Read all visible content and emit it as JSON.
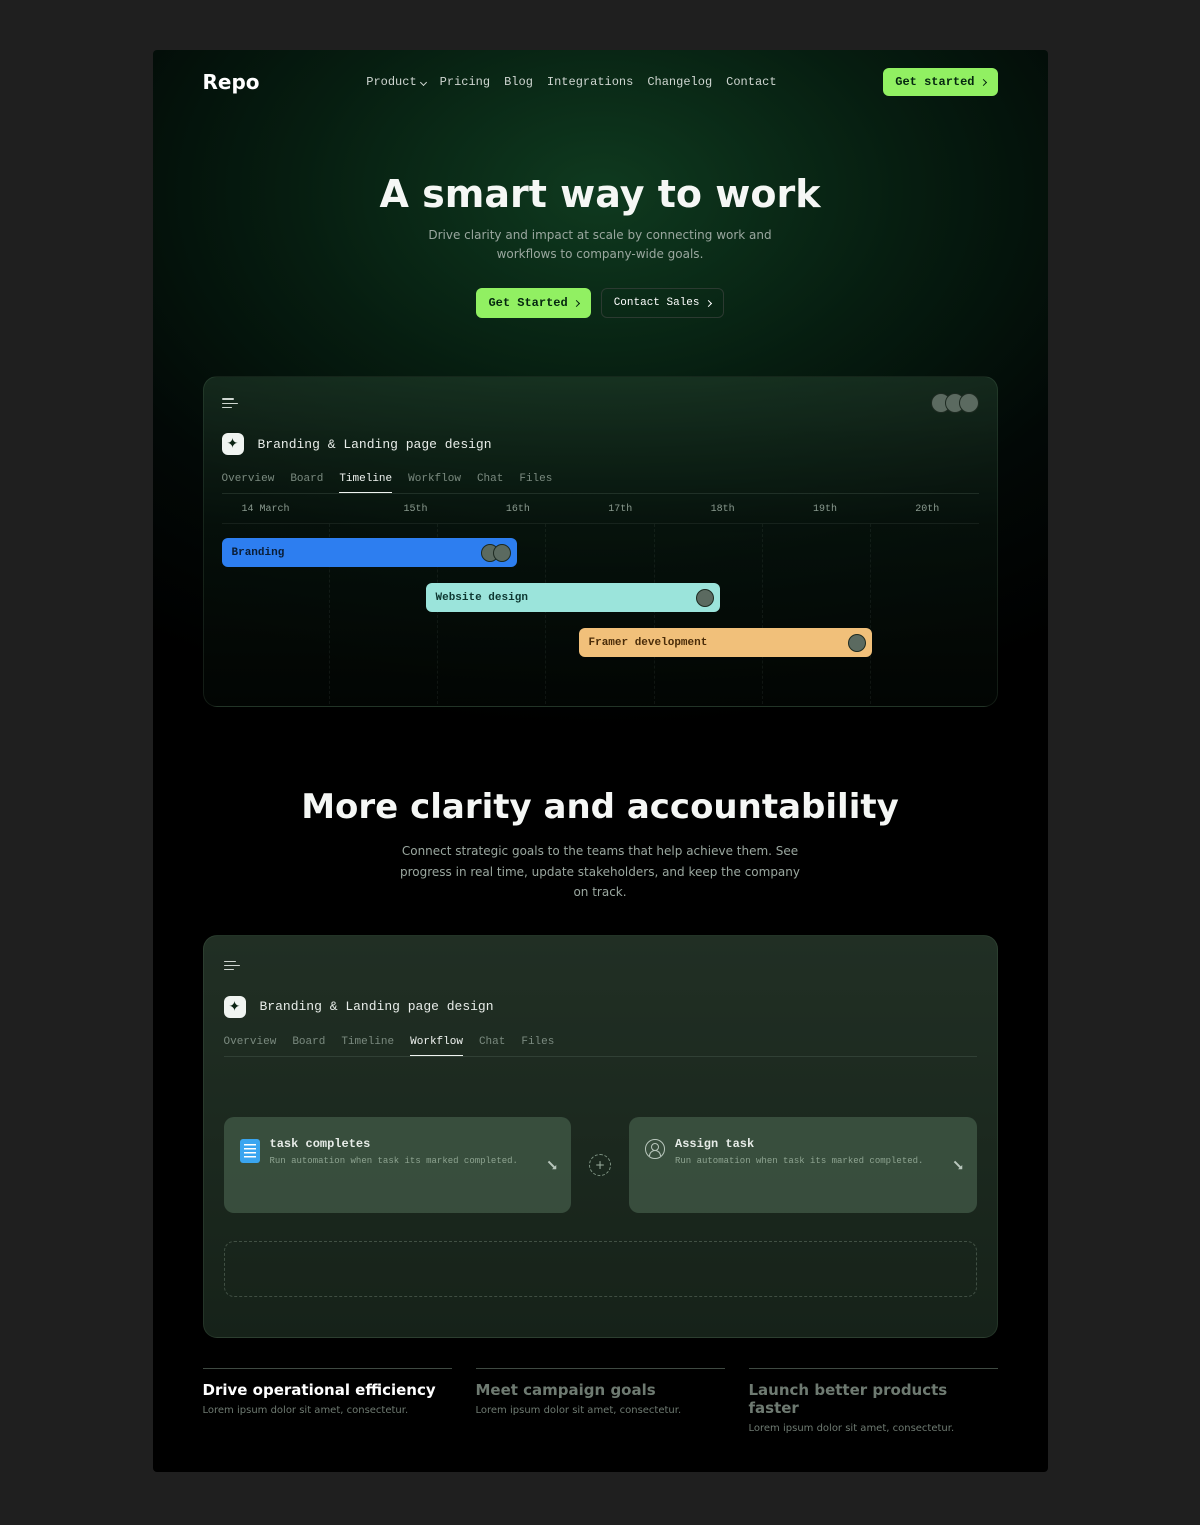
{
  "nav": {
    "logo": "Repo",
    "links": [
      "Product",
      "Pricing",
      "Blog",
      "Integrations",
      "Changelog",
      "Contact"
    ],
    "cta": "Get started"
  },
  "hero": {
    "title": "A smart way to work",
    "subtitle": "Drive clarity and impact at scale by connecting work and workflows to company-wide goals.",
    "primary": "Get Started",
    "secondary": "Contact Sales"
  },
  "panel": {
    "title": "Branding & Landing page design",
    "tabs": [
      "Overview",
      "Board",
      "Timeline",
      "Workflow",
      "Chat",
      "Files"
    ],
    "activeTab": "Timeline",
    "dates": [
      "14 March",
      "15th",
      "16th",
      "17th",
      "18th",
      "19th",
      "20th"
    ],
    "bars": {
      "b1": "Branding",
      "b2": "Website design",
      "b3": "Framer development"
    }
  },
  "section2": {
    "title": "More clarity and accountability",
    "subtitle": "Connect strategic goals to the teams that help achieve them. See progress in real time, update stakeholders, and keep the company on track."
  },
  "panel2": {
    "title": "Branding & Landing page design",
    "tabs": [
      "Overview",
      "Board",
      "Timeline",
      "Workflow",
      "Chat",
      "Files"
    ],
    "activeTab": "Workflow",
    "card1": {
      "title": "task completes",
      "sub": "Run automation when task its marked completed."
    },
    "card2": {
      "title": "Assign task",
      "sub": "Run automation when task its marked completed."
    }
  },
  "features": {
    "f1": {
      "h": "Drive operational efficiency",
      "p": "Lorem ipsum dolor sit amet, consectetur."
    },
    "f2": {
      "h": "Meet campaign goals",
      "p": "Lorem ipsum dolor sit amet, consectetur."
    },
    "f3": {
      "h": "Launch better products faster",
      "p": "Lorem ipsum dolor sit amet, consectetur."
    }
  }
}
